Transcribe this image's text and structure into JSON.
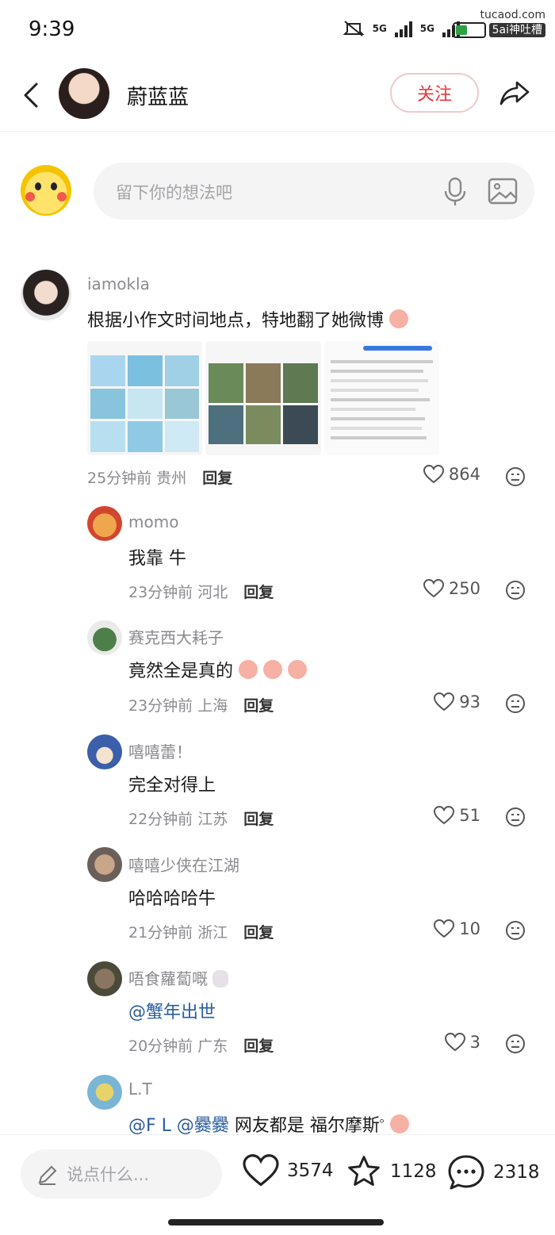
{
  "status_bar": {
    "time": "9:39",
    "network1": "5G",
    "network2": "5G",
    "watermark_top": "tucaod.com",
    "watermark_bottom": "5ai神吐槽"
  },
  "header": {
    "name": "蔚蓝蓝",
    "follow_label": "关注"
  },
  "composer": {
    "placeholder": "留下你的想法吧"
  },
  "comments": [
    {
      "user": "iamokla",
      "text": "根据小作文时间地点，特地翻了她微博",
      "time": "25分钟前",
      "location": "贵州",
      "reply": "回复",
      "likes": "864"
    },
    {
      "user": "momo",
      "text": "我靠 牛",
      "time": "23分钟前",
      "location": "河北",
      "reply": "回复",
      "likes": "250"
    },
    {
      "user": "赛克西大耗子",
      "text": "竟然全是真的",
      "time": "23分钟前",
      "location": "上海",
      "reply": "回复",
      "likes": "93"
    },
    {
      "user": "嘻嘻蕾！",
      "text": "完全对得上",
      "time": "22分钟前",
      "location": "江苏",
      "reply": "回复",
      "likes": "51"
    },
    {
      "user": "嘻嘻少侠在江湖",
      "text": "哈哈哈哈牛",
      "time": "21分钟前",
      "location": "浙江",
      "reply": "回复",
      "likes": "10"
    },
    {
      "user": "唔食蘿蔔嘅",
      "text": "@蟹年出世",
      "time": "20分钟前",
      "location": "广东",
      "reply": "回复",
      "likes": "3"
    },
    {
      "user": "L.T",
      "mention1": "@F L",
      "mention2": "@爨爨",
      "text": "网友都是 福尔摩斯",
      "text_suffix": "ᵒ"
    }
  ],
  "bottom_bar": {
    "placeholder": "说点什么...",
    "likes": "3574",
    "favorites": "1128",
    "comments": "2318"
  },
  "colors": {
    "accent_red": "#e8383d",
    "mention_blue": "#2a5d9f",
    "muted_gray": "#8a8a8f"
  }
}
